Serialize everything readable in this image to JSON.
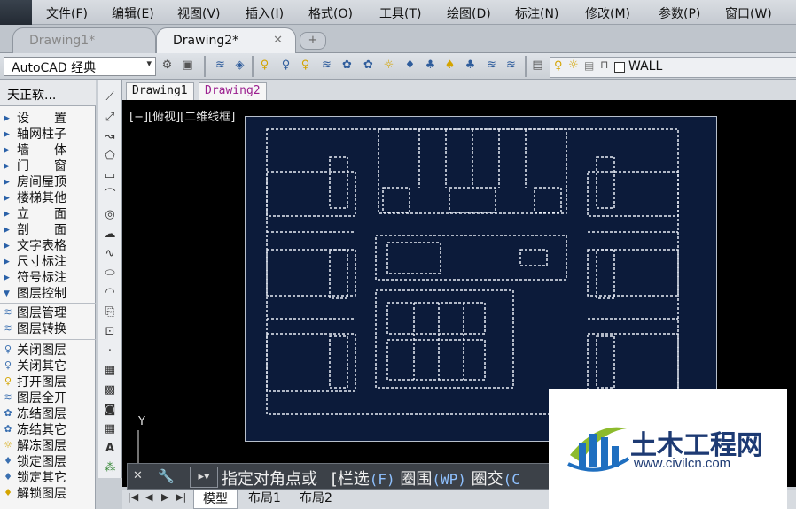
{
  "menubar": {
    "items": [
      "文件(F)",
      "编辑(E)",
      "视图(V)",
      "插入(I)",
      "格式(O)",
      "工具(T)",
      "绘图(D)",
      "标注(N)",
      "修改(M)",
      "参数(P)",
      "窗口(W)"
    ]
  },
  "doc_tabs": [
    {
      "label": "Drawing1*",
      "active": false
    },
    {
      "label": "Drawing2*",
      "active": true
    }
  ],
  "toolbar": {
    "workspace": "AutoCAD 经典",
    "layer_name": "WALL"
  },
  "tz_panel": {
    "title": "天正软...",
    "menu": [
      "设　　置",
      "轴网柱子",
      "墙　　体",
      "门　　窗",
      "房间屋顶",
      "楼梯其他",
      "立　　面",
      "剖　　面",
      "文字表格",
      "尺寸标注",
      "符号标注"
    ],
    "open_group": "图层控制",
    "sub_a": [
      "图层管理",
      "图层转换"
    ],
    "sub_b": [
      "关闭图层",
      "关闭其它",
      "打开图层",
      "图层全开",
      "冻结图层",
      "冻结其它",
      "解冻图层",
      "锁定图层",
      "锁定其它",
      "解锁图层"
    ]
  },
  "drawing_tabs": [
    "Drawing1",
    "Drawing2"
  ],
  "canvas": {
    "viewport_label": "[−][俯视][二维线框]",
    "axis_label": "Y"
  },
  "command": {
    "prompt": "指定对角点或",
    "options": [
      {
        "label": "栏选",
        "key": "(F)"
      },
      {
        "label": "圈围",
        "key": "(WP)"
      },
      {
        "label": "圈交",
        "key": "(C"
      }
    ]
  },
  "layout_tabs": [
    "模型",
    "布局1",
    "布局2"
  ],
  "watermark": {
    "title": "土木工程网",
    "url": "www.civilcn.com"
  },
  "colors": {
    "canvas_bg": "#000000",
    "plan_bg": "#0c1b3a",
    "accent": "#1d3a73"
  }
}
